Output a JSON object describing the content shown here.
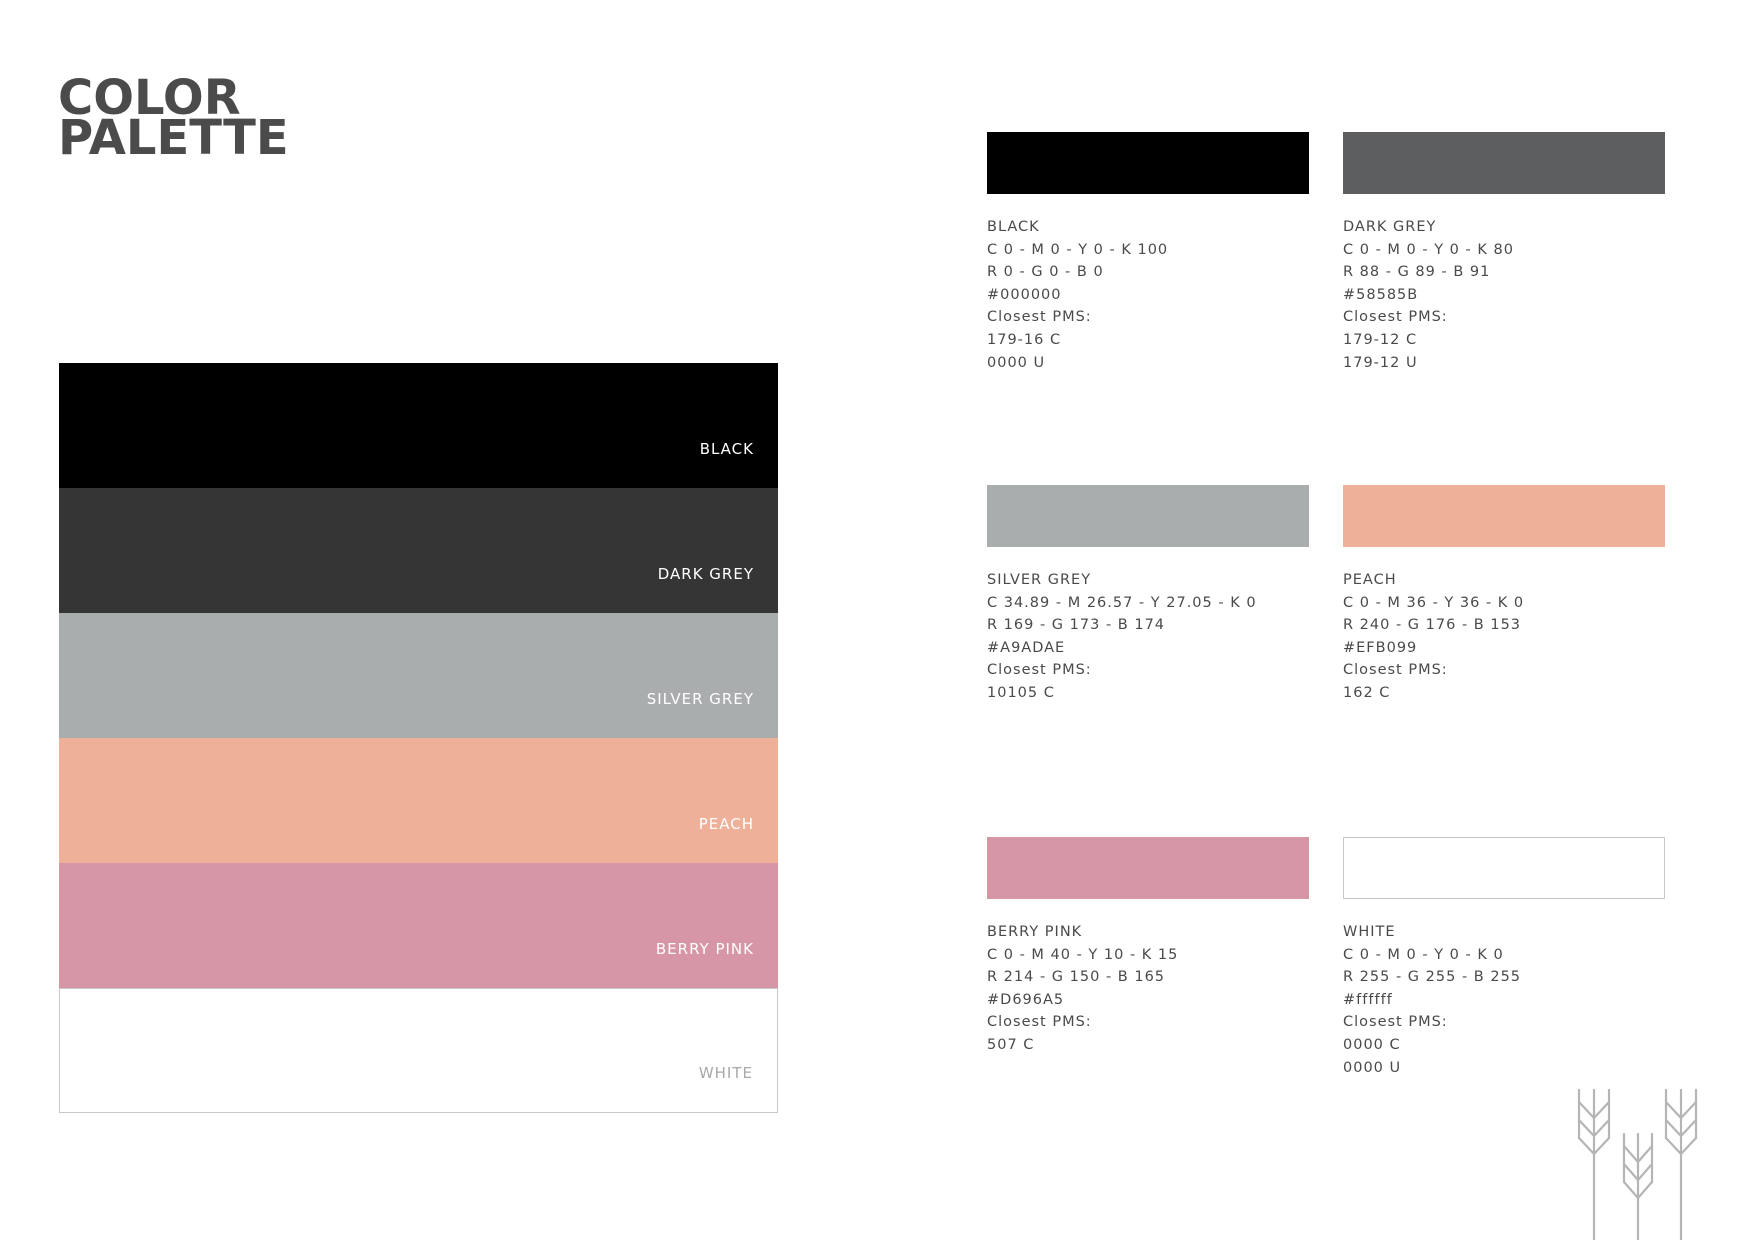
{
  "title": "COLOR\nPALETTE",
  "stack": [
    {
      "label": "BLACK",
      "color": "#000000",
      "text_color": "#ffffff"
    },
    {
      "label": "DARK GREY",
      "color": "#353535",
      "text_color": "#ffffff"
    },
    {
      "label": "SILVER GREY",
      "color": "#A9ADAE",
      "text_color": "#ffffff"
    },
    {
      "label": "PEACH",
      "color": "#EFB099",
      "text_color": "#ffffff"
    },
    {
      "label": "BERRY PINK",
      "color": "#D696A5",
      "text_color": "#ffffff"
    },
    {
      "label": "WHITE",
      "color": "#ffffff",
      "text_color": "#a8a8a8"
    }
  ],
  "cards": [
    {
      "name": "BLACK",
      "color": "#000000",
      "cmyk": "C 0 - M 0 - Y 0 - K 100",
      "rgb": "R 0 - G 0 - B 0",
      "hex": "#000000",
      "pms_label": "Closest PMS:",
      "pms": [
        "179-16 C",
        "0000 U"
      ]
    },
    {
      "name": "DARK GREY",
      "color": "#5d5e60",
      "cmyk": "C 0 - M 0 - Y 0 - K 80",
      "rgb": "R 88 - G 89 - B 91",
      "hex": "#58585B",
      "pms_label": "Closest PMS:",
      "pms": [
        "179-12 C",
        "179-12 U"
      ]
    },
    {
      "name": "SILVER GREY",
      "color": "#A9ADAE",
      "cmyk": "C 34.89 - M 26.57 - Y 27.05 - K 0",
      "rgb": "R 169 - G 173 - B 174",
      "hex": "#A9ADAE",
      "pms_label": "Closest PMS:",
      "pms": [
        "10105 C"
      ]
    },
    {
      "name": "PEACH",
      "color": "#EFB099",
      "cmyk": "C 0 - M 36 - Y 36 - K 0",
      "rgb": "R 240 - G 176 - B 153",
      "hex": "#EFB099",
      "pms_label": "Closest PMS:",
      "pms": [
        "162 C"
      ]
    },
    {
      "name": "BERRY PINK",
      "color": "#D696A5",
      "cmyk": "C 0 - M 40 - Y 10 - K 15",
      "rgb": "R 214 - G 150 - B 165",
      "hex": "#D696A5",
      "pms_label": "Closest PMS:",
      "pms": [
        "507 C"
      ]
    },
    {
      "name": "WHITE",
      "color": "#ffffff",
      "cmyk": "C 0 - M 0 - Y 0 - K 0",
      "rgb": "R 255 - G 255 - B 255",
      "hex": "#ffffff",
      "pms_label": "Closest PMS:",
      "pms": [
        "0000 C",
        "0000 U"
      ]
    }
  ],
  "decoration": {
    "icon": "wheat-icon",
    "color": "#b5b5b5"
  }
}
